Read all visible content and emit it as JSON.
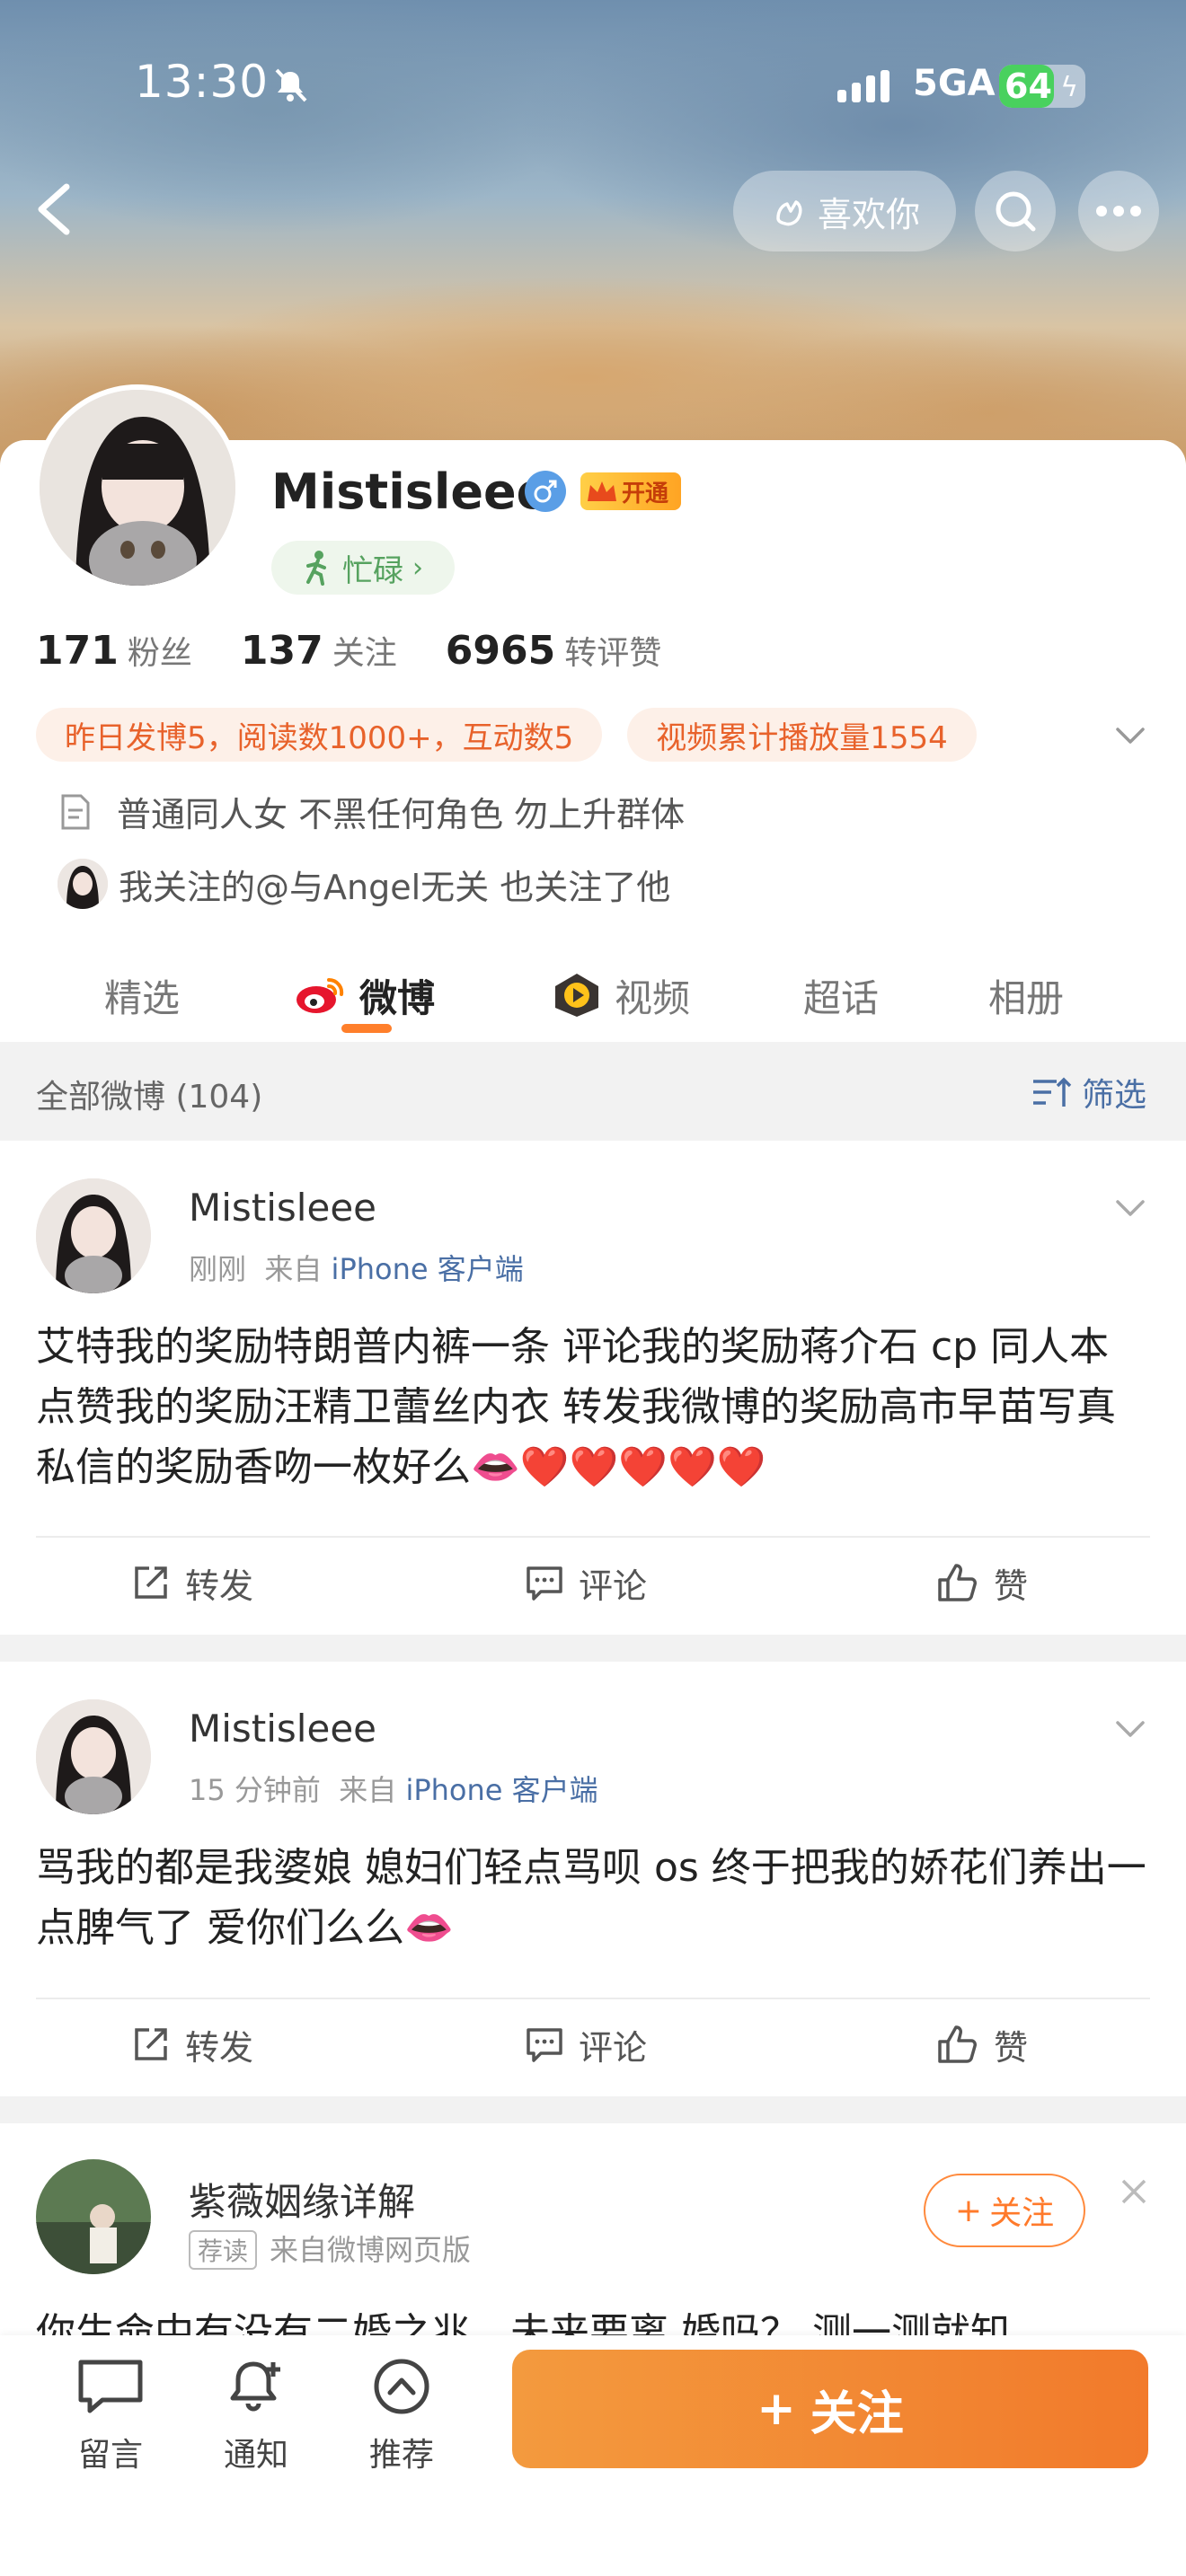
{
  "status": {
    "time": "13:30",
    "network": "5GA",
    "battery": "64",
    "battery_level": 0.64
  },
  "nav": {
    "like_label": "喜欢你"
  },
  "profile": {
    "name": "Mistisleee",
    "vip_label": "开通",
    "busy_label": "忙碌",
    "stats": [
      {
        "num": "171",
        "label": "粉丝"
      },
      {
        "num": "137",
        "label": "关注"
      },
      {
        "num": "6965",
        "label": "转评赞"
      }
    ],
    "tags": [
      "昨日发博5，阅读数1000+，互动数5",
      "视频累计播放量1554"
    ],
    "bio": "普通同人女 不黑任何角色 勿上升群体",
    "follow_hint": "我关注的@与Angel无关 也关注了他"
  },
  "tabs": [
    {
      "label": "精选"
    },
    {
      "label": "微博"
    },
    {
      "label": "视频"
    },
    {
      "label": "超话"
    },
    {
      "label": "相册"
    }
  ],
  "filterbar": {
    "all_label": "全部微博 (104)",
    "filter_label": "筛选"
  },
  "posts": [
    {
      "author": "Mistisleee",
      "time": "刚刚",
      "from": "来自",
      "source": "iPhone 客户端",
      "text": "艾特我的奖励特朗普内裤一条  评论我的奖励蒋介石 cp 同人本 点赞我的奖励汪精卫蕾丝内衣 转发我微博的奖励高市早苗写真 私信的奖励香吻一枚好么👄❤️❤️❤️❤️❤️"
    },
    {
      "author": "Mistisleee",
      "time": "15 分钟前",
      "from": "来自",
      "source": "iPhone 客户端",
      "text": "骂我的都是我婆娘 媳妇们轻点骂呗 os 终于把我的娇花们养出一点脾气了 爱你们么么👄"
    },
    {
      "author": "紫薇姻缘详解",
      "badge": "荐读",
      "source_text": "来自微博网页版",
      "follow_label": "关注",
      "text": "你生命中有没有二婚之兆，未来要离 婚吗？ 测一测就知"
    }
  ],
  "actions": {
    "repost": "转发",
    "comment": "评论",
    "like": "赞"
  },
  "bottombar": {
    "items": [
      {
        "label": "留言"
      },
      {
        "label": "通知"
      },
      {
        "label": "推荐"
      }
    ],
    "follow_label": "关注"
  }
}
